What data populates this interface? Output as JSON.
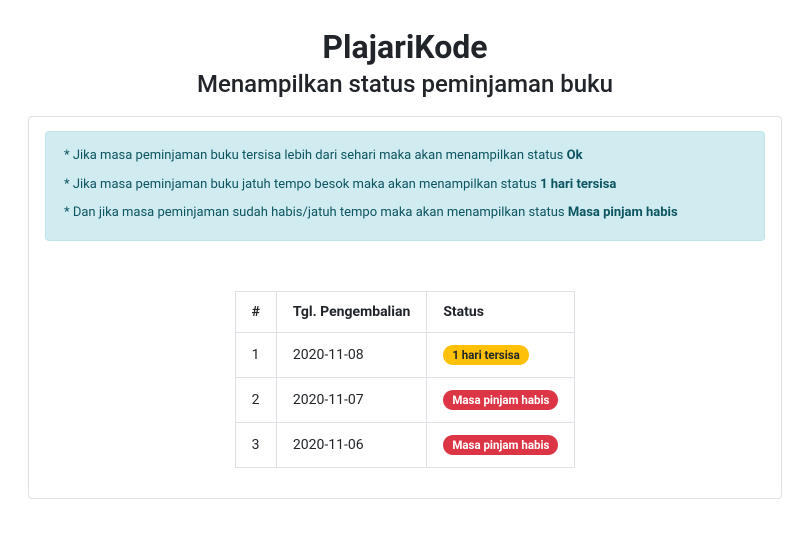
{
  "header": {
    "title": "PlajariKode",
    "subtitle": "Menampilkan status peminjaman buku"
  },
  "alert": {
    "line1_prefix": "* Jika masa peminjaman buku tersisa lebih dari sehari maka akan menampilkan status ",
    "line1_bold": "Ok",
    "line2_prefix": "* Jika masa peminjaman buku jatuh tempo besok maka akan menampilkan status ",
    "line2_bold": "1 hari tersisa",
    "line3_prefix": "* Dan jika masa peminjaman sudah habis/jatuh tempo maka akan menampilkan status ",
    "line3_bold": "Masa pinjam habis"
  },
  "table": {
    "headers": {
      "num": "#",
      "date": "Tgl. Pengembalian",
      "status": "Status"
    },
    "rows": [
      {
        "num": "1",
        "date": "2020-11-08",
        "status_label": "1 hari tersisa",
        "status_kind": "warning"
      },
      {
        "num": "2",
        "date": "2020-11-07",
        "status_label": "Masa pinjam habis",
        "status_kind": "danger"
      },
      {
        "num": "3",
        "date": "2020-11-06",
        "status_label": "Masa pinjam habis",
        "status_kind": "danger"
      }
    ]
  }
}
